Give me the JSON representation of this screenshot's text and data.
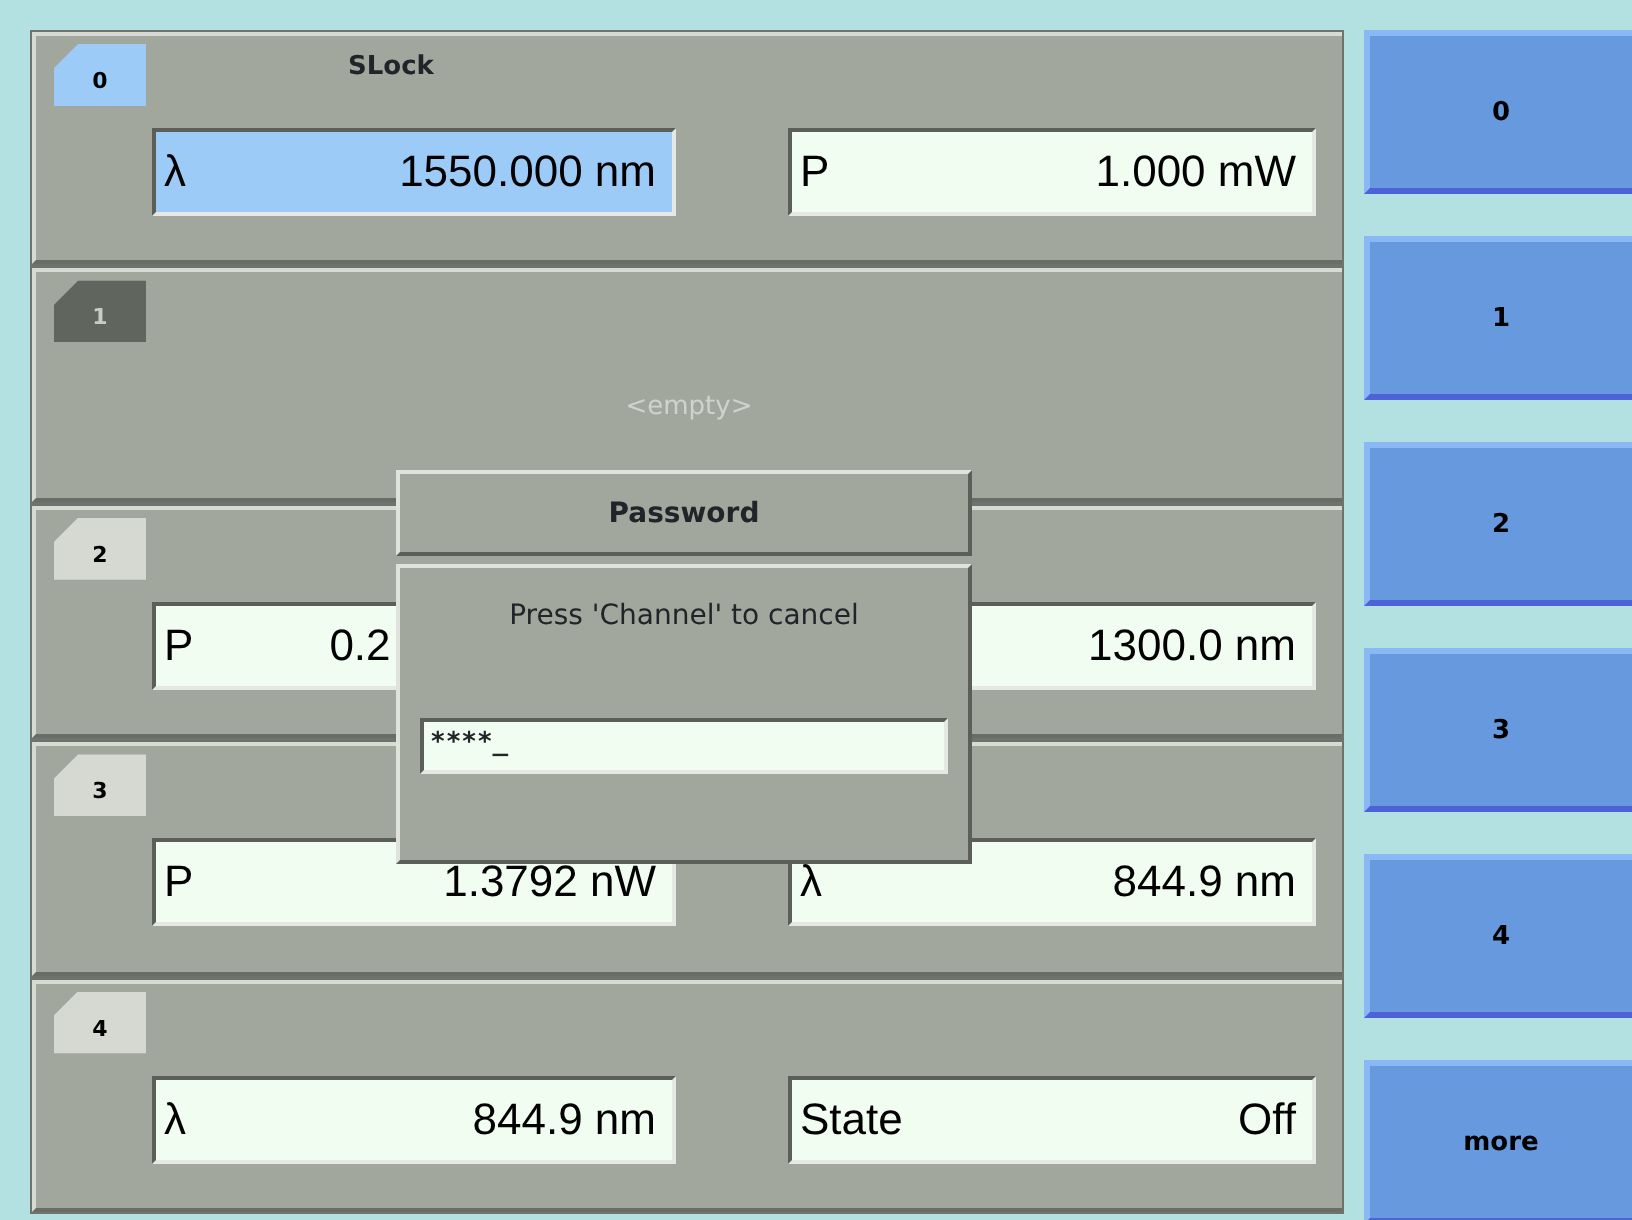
{
  "channels": [
    {
      "number": "0",
      "selected": true,
      "empty": false,
      "title": "SLock",
      "fields": [
        {
          "label": "λ",
          "value": "1550.000 nm",
          "selected": true
        },
        {
          "label": "P",
          "value": "1.000 mW",
          "selected": false
        }
      ]
    },
    {
      "number": "1",
      "selected": false,
      "empty": true,
      "placeholder": "<empty>"
    },
    {
      "number": "2",
      "selected": false,
      "empty": false,
      "fields": [
        {
          "label": "P",
          "value": "0.2",
          "selected": false,
          "cut": true
        },
        {
          "value": "1300.0 nm",
          "selected": false
        }
      ]
    },
    {
      "number": "3",
      "selected": false,
      "empty": false,
      "fields": [
        {
          "label": "P",
          "value": "1.3792 nW",
          "selected": false
        },
        {
          "label": "λ",
          "value": "844.9 nm",
          "selected": false
        }
      ]
    },
    {
      "number": "4",
      "selected": false,
      "empty": false,
      "fields": [
        {
          "label": "λ",
          "value": "844.9 nm",
          "selected": false
        },
        {
          "label": "State",
          "value": "Off",
          "selected": false
        }
      ]
    }
  ],
  "dialog": {
    "title": "Password",
    "message": "Press 'Channel' to cancel",
    "value": "****_"
  },
  "softkeys": [
    "0",
    "1",
    "2",
    "3",
    "4",
    "more"
  ]
}
